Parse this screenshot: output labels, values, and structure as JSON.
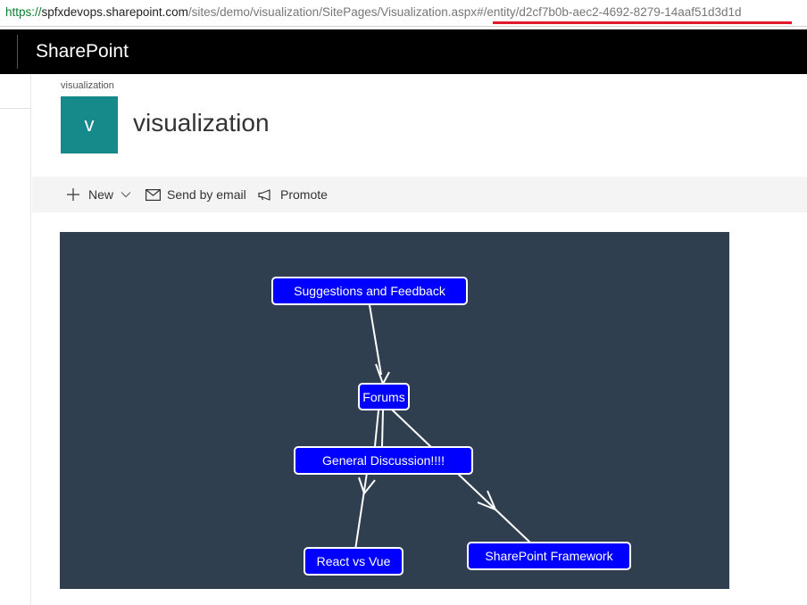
{
  "browser": {
    "url_scheme": "https://",
    "url_host": "spfxdevops.sharepoint.com",
    "url_path": "/sites/demo/visualization/SitePages/Visualization.aspx",
    "url_hash": "#/entity/d2cf7b0b-aec2-4692-8279-14aaf51d3d1d",
    "highlight_color": "#e0192b"
  },
  "suite": {
    "brand": "SharePoint"
  },
  "site": {
    "breadcrumb": "visualization",
    "logo_letter": "v",
    "logo_color": "#168a8a",
    "title": "visualization"
  },
  "command_bar": {
    "new_label": "New",
    "send_label": "Send by email",
    "promote_label": "Promote"
  },
  "graph": {
    "background": "#2f3f50",
    "node_color": "#0000ff",
    "nodes": {
      "suggestions": "Suggestions and Feedback",
      "forums": "Forums",
      "general": "General Discussion!!!!",
      "react": "React vs Vue",
      "spfx": "SharePoint Framework"
    },
    "edges": [
      {
        "from": "Suggestions and Feedback",
        "to": "Forums"
      },
      {
        "from": "General Discussion!!!!",
        "to": "Forums"
      },
      {
        "from": "Forums",
        "to": "SharePoint Framework"
      },
      {
        "from": "React vs Vue",
        "to": "General Discussion!!!!"
      }
    ]
  }
}
